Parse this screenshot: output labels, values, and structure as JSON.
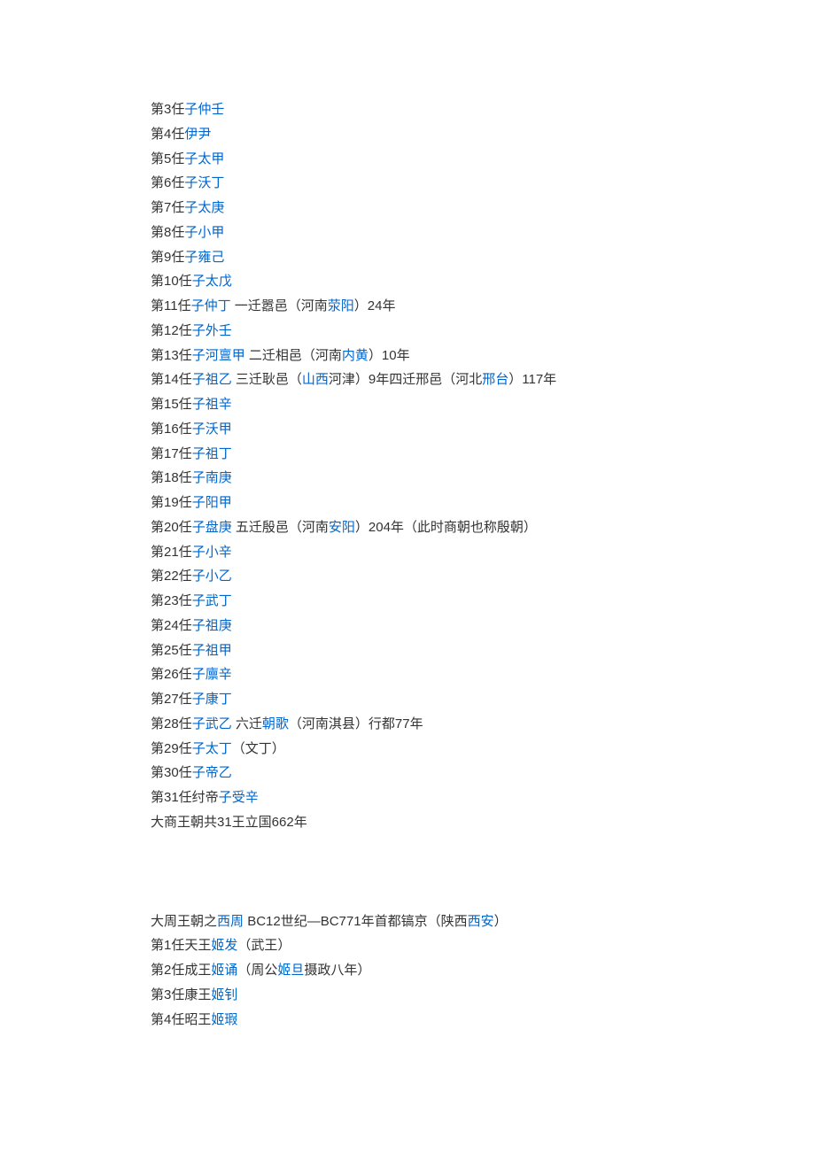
{
  "shang": [
    {
      "prefix": "第3任",
      "link": "子仲壬"
    },
    {
      "prefix": "第4任",
      "link": "伊尹"
    },
    {
      "prefix": "第5任",
      "link": "子太甲"
    },
    {
      "prefix": "第6任",
      "link": "子沃丁"
    },
    {
      "prefix": "第7任",
      "link": "子太庚"
    },
    {
      "prefix": "第8任",
      "link": "子小甲"
    },
    {
      "prefix": "第9任",
      "link": "子雍己"
    },
    {
      "prefix": "第10任",
      "link": "子太戊"
    },
    {
      "prefix": "第11任",
      "link": "子仲丁",
      "parts": [
        {
          "t": " 一迁嚣邑（河南"
        },
        {
          "l": "荥阳"
        },
        {
          "t": "）24年"
        }
      ]
    },
    {
      "prefix": "第12任",
      "link": "子外壬"
    },
    {
      "prefix": "第13任",
      "link": "子河亶甲",
      "parts": [
        {
          "t": " 二迁相邑（河南"
        },
        {
          "l": "内黄"
        },
        {
          "t": "）10年"
        }
      ]
    },
    {
      "prefix": "第14任",
      "link": "子祖乙",
      "parts": [
        {
          "t": " 三迁耿邑（"
        },
        {
          "l": "山西"
        },
        {
          "t": "河津）9年四迁邢邑（河北"
        },
        {
          "l": "邢台"
        },
        {
          "t": "）117年"
        }
      ]
    },
    {
      "prefix": "第15任",
      "link": "子祖辛"
    },
    {
      "prefix": "第16任",
      "link": "子沃甲"
    },
    {
      "prefix": "第17任",
      "link": "子祖丁"
    },
    {
      "prefix": "第18任",
      "link": "子南庚"
    },
    {
      "prefix": "第19任",
      "link": "子阳甲"
    },
    {
      "prefix": "第20任",
      "link": "子盘庚",
      "parts": [
        {
          "t": " 五迁殷邑（河南"
        },
        {
          "l": "安阳"
        },
        {
          "t": "）204年（此时商朝也称殷朝）"
        }
      ]
    },
    {
      "prefix": "第21任",
      "link": "子小辛"
    },
    {
      "prefix": "第22任",
      "link": "子小乙"
    },
    {
      "prefix": "第23任",
      "link": "子武丁"
    },
    {
      "prefix": "第24任",
      "link": "子祖庚"
    },
    {
      "prefix": "第25任",
      "link": "子祖甲"
    },
    {
      "prefix": "第26任",
      "link": "子廪辛"
    },
    {
      "prefix": "第27任",
      "link": "子康丁"
    },
    {
      "prefix": "第28任",
      "link": "子武乙",
      "parts": [
        {
          "t": " 六迁"
        },
        {
          "l": "朝歌"
        },
        {
          "t": "（河南淇县）行都77年"
        }
      ]
    },
    {
      "prefix": "第29任",
      "link": "子太丁",
      "suffix": "（文丁）"
    },
    {
      "prefix": "第30任",
      "link": "子帝乙"
    },
    {
      "prefix": "第31任纣帝",
      "link": "子受辛"
    }
  ],
  "shang_summary": "大商王朝共31王立国662年",
  "zhou_header": {
    "pre": "大周王朝之",
    "link1": "西周",
    "mid": " BC12世纪—BC771年首都镐京（陕西",
    "link2": "西安",
    "post": "）"
  },
  "zhou": [
    {
      "prefix": "第1任天王",
      "link": "姬发",
      "suffix": "（武王）"
    },
    {
      "prefix": "第2任成王",
      "link": "姬诵",
      "parts": [
        {
          "t": "（周公"
        },
        {
          "l": "姬旦"
        },
        {
          "t": "摄政八年）"
        }
      ]
    },
    {
      "prefix": "第3任康王",
      "link": "姬钊"
    },
    {
      "prefix": "第4任昭王",
      "link": "姬瑕"
    }
  ]
}
